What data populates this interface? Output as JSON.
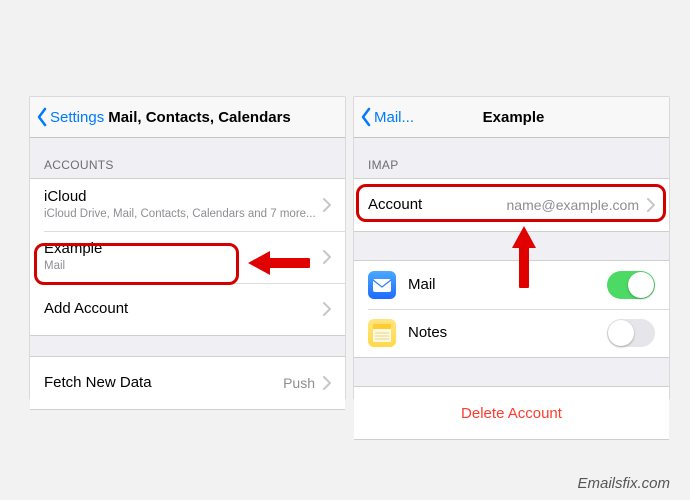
{
  "left": {
    "back_label": "Settings",
    "title": "Mail, Contacts, Calendars",
    "sections": {
      "accounts": {
        "header": "Accounts",
        "rows": {
          "icloud": {
            "label": "iCloud",
            "sub": "iCloud Drive, Mail, Contacts, Calendars and 7 more..."
          },
          "example": {
            "label": "Example",
            "sub": "Mail"
          },
          "add": {
            "label": "Add Account"
          }
        }
      },
      "fetch": {
        "label": "Fetch New Data",
        "detail": "Push"
      }
    }
  },
  "right": {
    "back_label": "Mail...",
    "title": "Example",
    "sections": {
      "imap": {
        "header": "IMAP",
        "account_label": "Account",
        "account_value": "name@example.com"
      },
      "services": {
        "mail": {
          "label": "Mail",
          "on": true
        },
        "notes": {
          "label": "Notes",
          "on": false
        }
      },
      "delete": {
        "label": "Delete Account"
      }
    }
  },
  "watermark": "Emailsfix.com"
}
